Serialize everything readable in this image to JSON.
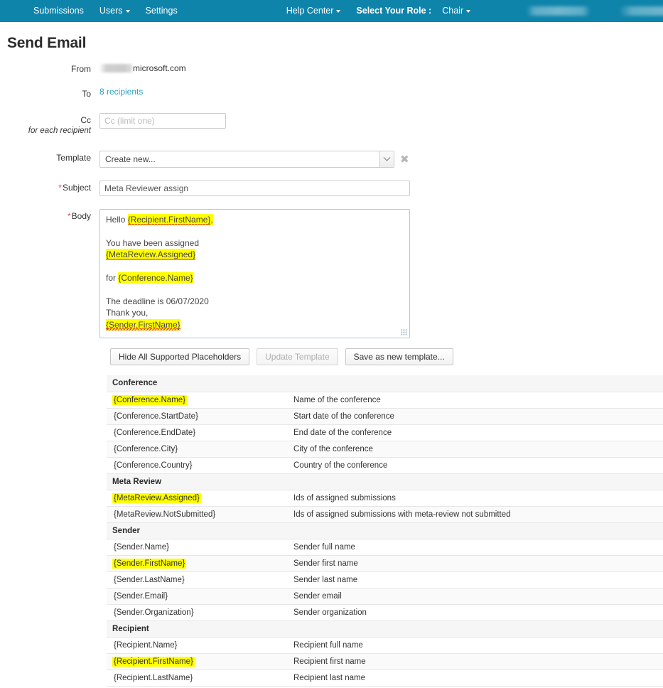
{
  "navbar": {
    "left_items": [
      {
        "label": "Submissions",
        "caret": false
      },
      {
        "label": "Users",
        "caret": true
      },
      {
        "label": "Settings",
        "caret": false
      }
    ],
    "help_center": "Help Center",
    "role_label": "Select Your Role :",
    "role_value": "Chair",
    "background_color": "#0e84ab"
  },
  "page": {
    "title": "Send Email"
  },
  "form": {
    "from": {
      "label": "From",
      "redacted": true,
      "domain": "microsoft.com"
    },
    "to": {
      "label": "To",
      "link_text": "8 recipients"
    },
    "cc": {
      "label": "Cc",
      "sub_label": "for each recipient",
      "value": "",
      "placeholder": "Cc (limit one)"
    },
    "template": {
      "label": "Template",
      "selected": "Create new...",
      "clear_symbol": "✖"
    },
    "subject": {
      "label": "Subject",
      "required_marker": "*",
      "value": "Meta Reviewer assign"
    },
    "body": {
      "label": "Body",
      "required_marker": "*",
      "lines": [
        [
          {
            "text": "Hello ",
            "highlight": false,
            "spell": false
          },
          {
            "text": "{Recipient.FirstName}",
            "highlight": true,
            "spell": true
          },
          {
            "text": ",",
            "highlight": true,
            "spell": false
          }
        ],
        [],
        [
          {
            "text": "You have been assigned",
            "highlight": false,
            "spell": false
          }
        ],
        [
          {
            "text": "{MetaReview.Assigned}",
            "highlight": true,
            "spell": true
          }
        ],
        [],
        [
          {
            "text": "for ",
            "highlight": false,
            "spell": false
          },
          {
            "text": "{Conference.Name}",
            "highlight": true,
            "spell": false
          }
        ],
        [],
        [
          {
            "text": "The deadline is 06/07/2020",
            "highlight": false,
            "spell": false
          }
        ],
        [
          {
            "text": "Thank you,",
            "highlight": false,
            "spell": false
          }
        ],
        [
          {
            "text": "{Sender.FirstName}",
            "highlight": true,
            "spell": true
          }
        ]
      ]
    }
  },
  "buttons": {
    "hide_placeholders": "Hide All Supported Placeholders",
    "update_template": "Update Template",
    "update_template_disabled": true,
    "save_as_new_template": "Save as new template..."
  },
  "placeholders": {
    "highlight_color": "#ffff00",
    "sections": [
      {
        "name": "Conference",
        "rows": [
          {
            "token": "{Conference.Name}",
            "description": "Name of the conference",
            "highlighted": true
          },
          {
            "token": "{Conference.StartDate}",
            "description": "Start date of the conference",
            "highlighted": false
          },
          {
            "token": "{Conference.EndDate}",
            "description": "End date of the conference",
            "highlighted": false
          },
          {
            "token": "{Conference.City}",
            "description": "City of the conference",
            "highlighted": false
          },
          {
            "token": "{Conference.Country}",
            "description": "Country of the conference",
            "highlighted": false
          }
        ]
      },
      {
        "name": "Meta Review",
        "rows": [
          {
            "token": "{MetaReview.Assigned}",
            "description": "Ids of assigned submissions",
            "highlighted": true
          },
          {
            "token": "{MetaReview.NotSubmitted}",
            "description": "Ids of assigned submissions with meta-review not submitted",
            "highlighted": false
          }
        ]
      },
      {
        "name": "Sender",
        "rows": [
          {
            "token": "{Sender.Name}",
            "description": "Sender full name",
            "highlighted": false
          },
          {
            "token": "{Sender.FirstName}",
            "description": "Sender first name",
            "highlighted": true
          },
          {
            "token": "{Sender.LastName}",
            "description": "Sender last name",
            "highlighted": false
          },
          {
            "token": "{Sender.Email}",
            "description": "Sender email",
            "highlighted": false
          },
          {
            "token": "{Sender.Organization}",
            "description": "Sender organization",
            "highlighted": false
          }
        ]
      },
      {
        "name": "Recipient",
        "rows": [
          {
            "token": "{Recipient.Name}",
            "description": "Recipient full name",
            "highlighted": false
          },
          {
            "token": "{Recipient.FirstName}",
            "description": "Recipient first name",
            "highlighted": true
          },
          {
            "token": "{Recipient.LastName}",
            "description": "Recipient last name",
            "highlighted": false
          }
        ]
      }
    ]
  }
}
